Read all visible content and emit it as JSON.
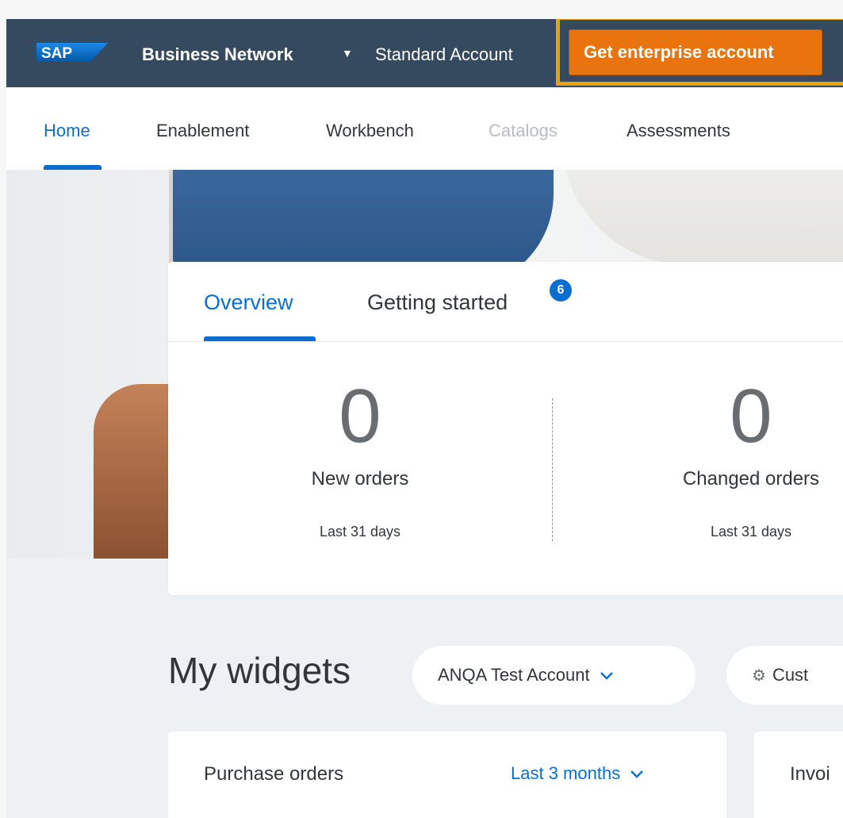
{
  "shell": {
    "logo_text": "SAP",
    "product": "Business Network",
    "account_type": "Standard Account",
    "cta_label": "Get enterprise account",
    "colors": {
      "shell_bg": "#354a5f",
      "cta_bg": "#e9730c",
      "highlight": "#e8a20c"
    }
  },
  "nav": {
    "items": [
      {
        "label": "Home",
        "state": "active"
      },
      {
        "label": "Enablement",
        "state": "normal"
      },
      {
        "label": "Workbench",
        "state": "normal"
      },
      {
        "label": "Catalogs",
        "state": "disabled"
      },
      {
        "label": "Assessments",
        "state": "normal"
      }
    ]
  },
  "overview": {
    "tabs": [
      {
        "label": "Overview",
        "active": true
      },
      {
        "label": "Getting started",
        "badge": "6"
      }
    ],
    "metrics": [
      {
        "value": "0",
        "label": "New orders",
        "period": "Last 31 days"
      },
      {
        "value": "0",
        "label": "Changed orders",
        "period": "Last 31 days"
      }
    ]
  },
  "widgets": {
    "title": "My widgets",
    "account_select": "ANQA Test Account",
    "customize_label": "Cust",
    "cards": [
      {
        "title": "Purchase orders",
        "period": "Last 3 months"
      },
      {
        "title": "Invoi"
      }
    ]
  },
  "icons": [
    "chevron-down-icon",
    "customize-icon",
    "caret-down-icon"
  ],
  "accent_color": "#0a6ed1"
}
